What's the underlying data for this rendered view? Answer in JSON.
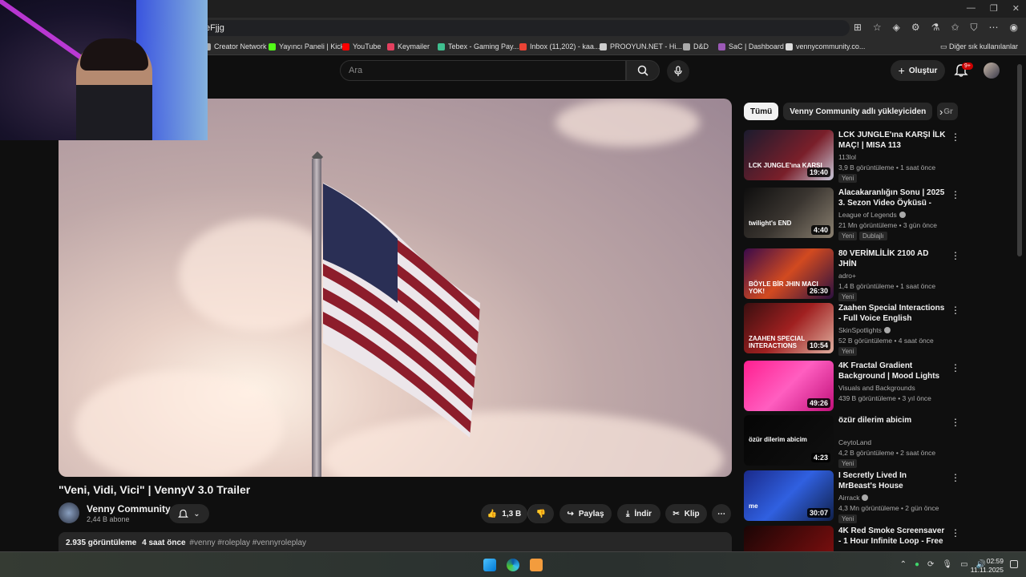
{
  "browser": {
    "url": "eFjjg",
    "win_min": "—",
    "win_max": "❐",
    "win_close": "✕",
    "bookmarks": [
      {
        "label": "Creator Network",
        "color": "#aaaaaa"
      },
      {
        "label": "Yayıncı Paneli | Kick",
        "color": "#53fc18"
      },
      {
        "label": "YouTube",
        "color": "#ff0000"
      },
      {
        "label": "Keymailer",
        "color": "#e4405f"
      },
      {
        "label": "Tebex - Gaming Pay...",
        "color": "#3fbf8f"
      },
      {
        "label": "Inbox (11,202) - kaa...",
        "color": "#ea4335"
      },
      {
        "label": "PROOYUN.NET - Hi...",
        "color": "#cccccc"
      },
      {
        "label": "D&D",
        "color": "#aaaaaa"
      },
      {
        "label": "SaC | Dashboard",
        "color": "#9b59b6"
      },
      {
        "label": "vennycommunity.co...",
        "color": "#dddddd"
      }
    ],
    "bookmarks_other": "Diğer sık kullanılanlar"
  },
  "header": {
    "search_placeholder": "Ara",
    "create_label": "Oluştur",
    "notifications_count": "9+"
  },
  "video": {
    "title": "\"Veni, Vidi, Vici\" | VennyV 3.0 Trailer",
    "channel": "Venny Community",
    "subscribers": "2,44 B abone",
    "likes": "1,3 B",
    "share_label": "Paylaş",
    "download_label": "İndir",
    "clip_label": "Klip",
    "views": "2.935 görüntüleme",
    "age": "4 saat önce",
    "tags": "#venny #roleplay #vennyroleplay"
  },
  "chips": [
    "Tümü",
    "Venny Community adlı yükleyiciden",
    "Gr"
  ],
  "recommendations": [
    {
      "title": "LCK JUNGLE'ına KARŞI İLK MAÇ! | MISA 113",
      "channel": "113lol",
      "meta": "3,9 B görüntüleme • 1 saat önce",
      "badge": "Yeni",
      "duration": "19:40",
      "verified": false,
      "thumb_text": "LCK JUNGLE'ına KARŞI"
    },
    {
      "title": "Alacakaranlığın Sonu | 2025 3. Sezon Video Öyküsü - League ...",
      "channel": "League of Legends",
      "meta": "21 Mn görüntüleme • 3 gün önce",
      "badge": "Yeni",
      "badge2": "Dublajlı",
      "duration": "4:40",
      "verified": true,
      "thumb_text": "twilight's END"
    },
    {
      "title": "80 VERİMLİLİK 2100 AD JHİN",
      "channel": "adro+",
      "meta": "1,4 B görüntüleme • 1 saat önce",
      "badge": "Yeni",
      "duration": "26:30",
      "verified": false,
      "thumb_text": "BÖYLE BİR JHIN MAÇI YOK!"
    },
    {
      "title": "Zaahen Special Interactions - Full Voice English",
      "channel": "SkinSpotlights",
      "meta": "52 B görüntüleme • 4 saat önce",
      "badge": "Yeni",
      "duration": "10:54",
      "verified": true,
      "thumb_text": "ZAAHEN SPECIAL INTERACTIONS"
    },
    {
      "title": "4K Fractal Gradient Background | Mood Lights",
      "channel": "Visuals and Backgrounds",
      "meta": "439 B görüntüleme • 3 yıl önce",
      "badge": "",
      "duration": "49:26",
      "verified": false,
      "thumb_text": ""
    },
    {
      "title": "özür dilerim abicim",
      "channel": "CeytoLand",
      "meta": "4,2 B görüntüleme • 2 saat önce",
      "badge": "Yeni",
      "duration": "4:23",
      "verified": false,
      "thumb_text": "özür dilerim abicim"
    },
    {
      "title": "I Secretly Lived In MrBeast's House",
      "channel": "Airrack",
      "meta": "4,3 Mn görüntüleme • 2 gün önce",
      "badge": "Yeni",
      "duration": "30:07",
      "verified": true,
      "thumb_text": "me"
    },
    {
      "title": "4K Red Smoke Screensaver - 1 Hour  Infinite Loop -  Free ...",
      "channel": "",
      "meta": "",
      "badge": "",
      "duration": "",
      "verified": false,
      "thumb_text": "4K"
    }
  ],
  "taskbar": {
    "time": "02:59",
    "date": "11.11.2025"
  }
}
